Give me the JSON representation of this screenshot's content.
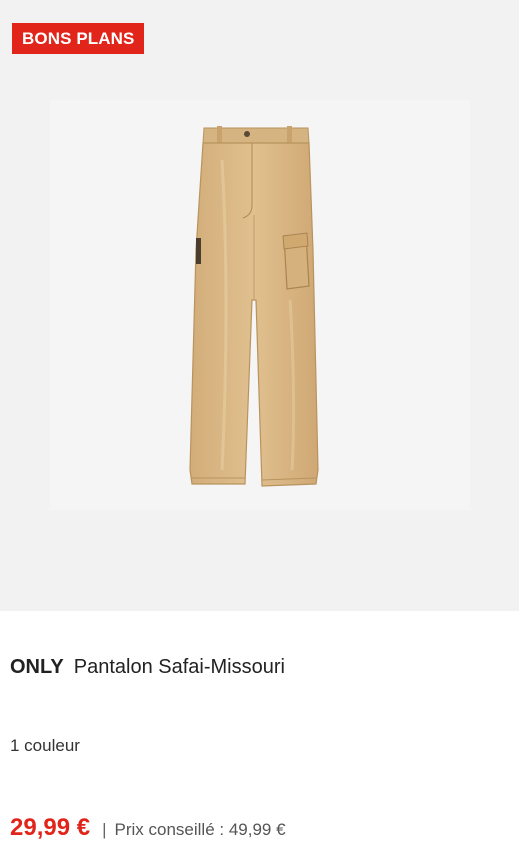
{
  "badge": {
    "label": "BONS PLANS"
  },
  "product": {
    "brand": "ONLY",
    "name": "Pantalon Safai-Missouri",
    "colors": "1 couleur",
    "price": "29,99 €",
    "separator": "|",
    "recommended_price": "Prix conseillé : 49,99 €",
    "image_icon": "cargo-pants-image"
  },
  "colors": {
    "badge_bg": "#e1251b",
    "price": "#e1251b",
    "image_bg": "#f2f2f2",
    "pants": "#d9b888"
  }
}
